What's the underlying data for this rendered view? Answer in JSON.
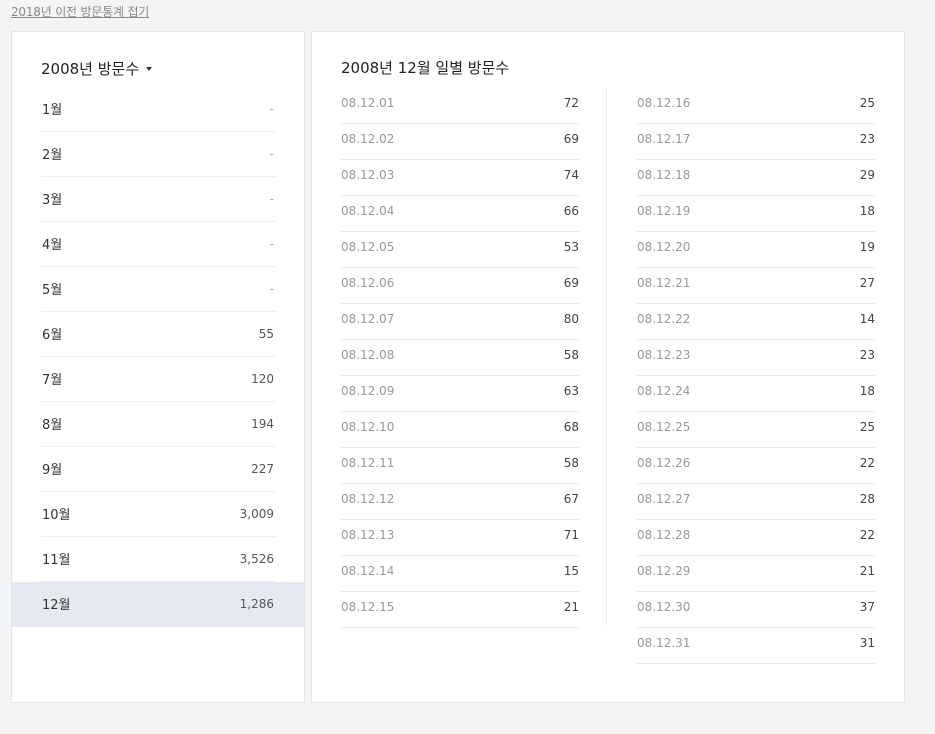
{
  "collapse_link": "2018년 이전 방문통계 접기",
  "year_selector": {
    "label": "2008년 방문수"
  },
  "months": [
    {
      "name": "1월",
      "value": "-"
    },
    {
      "name": "2월",
      "value": "-"
    },
    {
      "name": "3월",
      "value": "-"
    },
    {
      "name": "4월",
      "value": "-"
    },
    {
      "name": "5월",
      "value": "-"
    },
    {
      "name": "6월",
      "value": "55"
    },
    {
      "name": "7월",
      "value": "120"
    },
    {
      "name": "8월",
      "value": "194"
    },
    {
      "name": "9월",
      "value": "227"
    },
    {
      "name": "10월",
      "value": "3,009"
    },
    {
      "name": "11월",
      "value": "3,526"
    },
    {
      "name": "12월",
      "value": "1,286"
    }
  ],
  "selected_month_index": 11,
  "daily": {
    "title": "2008년 12월 일별 방문수",
    "col1": [
      {
        "date": "08.12.01",
        "value": "72"
      },
      {
        "date": "08.12.02",
        "value": "69"
      },
      {
        "date": "08.12.03",
        "value": "74"
      },
      {
        "date": "08.12.04",
        "value": "66"
      },
      {
        "date": "08.12.05",
        "value": "53"
      },
      {
        "date": "08.12.06",
        "value": "69"
      },
      {
        "date": "08.12.07",
        "value": "80"
      },
      {
        "date": "08.12.08",
        "value": "58"
      },
      {
        "date": "08.12.09",
        "value": "63"
      },
      {
        "date": "08.12.10",
        "value": "68"
      },
      {
        "date": "08.12.11",
        "value": "58"
      },
      {
        "date": "08.12.12",
        "value": "67"
      },
      {
        "date": "08.12.13",
        "value": "71"
      },
      {
        "date": "08.12.14",
        "value": "15"
      },
      {
        "date": "08.12.15",
        "value": "21"
      }
    ],
    "col2": [
      {
        "date": "08.12.16",
        "value": "25"
      },
      {
        "date": "08.12.17",
        "value": "23"
      },
      {
        "date": "08.12.18",
        "value": "29"
      },
      {
        "date": "08.12.19",
        "value": "18"
      },
      {
        "date": "08.12.20",
        "value": "19"
      },
      {
        "date": "08.12.21",
        "value": "27"
      },
      {
        "date": "08.12.22",
        "value": "14"
      },
      {
        "date": "08.12.23",
        "value": "23"
      },
      {
        "date": "08.12.24",
        "value": "18"
      },
      {
        "date": "08.12.25",
        "value": "25"
      },
      {
        "date": "08.12.26",
        "value": "22"
      },
      {
        "date": "08.12.27",
        "value": "28"
      },
      {
        "date": "08.12.28",
        "value": "22"
      },
      {
        "date": "08.12.29",
        "value": "21"
      },
      {
        "date": "08.12.30",
        "value": "37"
      },
      {
        "date": "08.12.31",
        "value": "31"
      }
    ]
  },
  "colors": {
    "selected_row_bg": "#e6eaf0",
    "page_bg": "#f3f4f6"
  }
}
